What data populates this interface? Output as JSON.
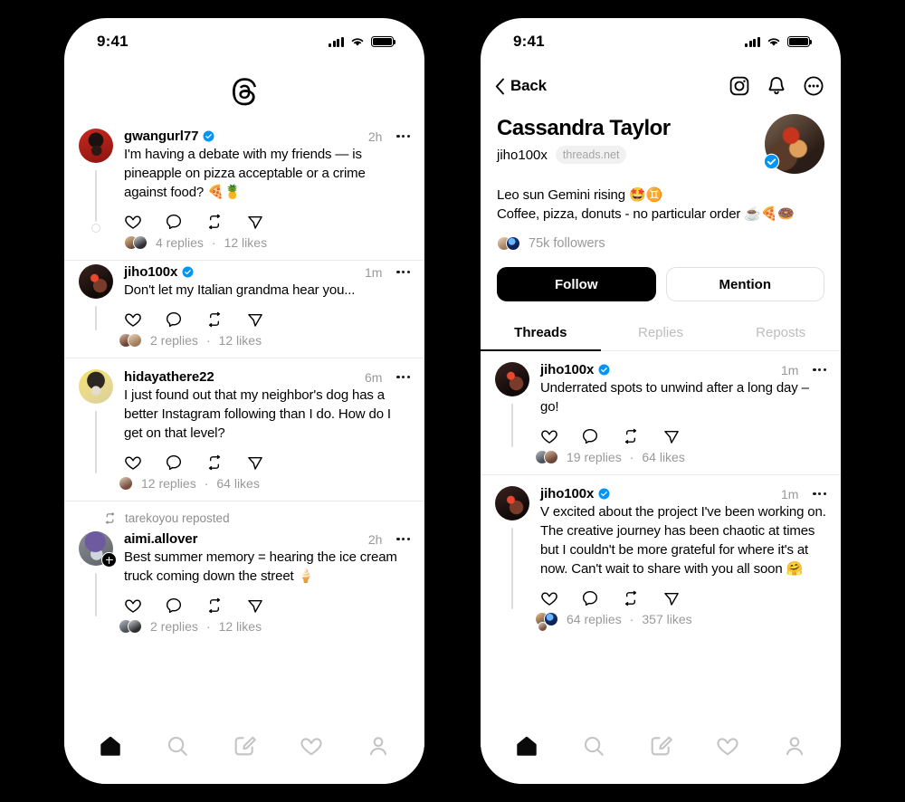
{
  "status_bar": {
    "time": "9:41",
    "signal_icon": "cellular-bars-icon",
    "wifi_icon": "wifi-icon",
    "battery_icon": "battery-full-icon"
  },
  "left_phone": {
    "header": {
      "logo": "threads-logo-icon"
    },
    "posts": [
      {
        "username": "gwangurl77",
        "verified": true,
        "timestamp": "2h",
        "text": "I'm having a debate with my friends — is pineapple on pizza acceptable or a crime against food? 🍕🍍",
        "replies": "4 replies",
        "separator": "·",
        "likes": "12 likes",
        "avatar": "a-gwangurl"
      },
      {
        "username": "jiho100x",
        "verified": true,
        "timestamp": "1m",
        "text": "Don't let my Italian grandma hear you...",
        "replies": "2 replies",
        "separator": "·",
        "likes": "12 likes",
        "avatar": "a-jiho"
      },
      {
        "username": "hidayathere22",
        "verified": false,
        "timestamp": "6m",
        "text": "I just found out that my neighbor's dog has a better Instagram following than I do. How do I get on that level?",
        "replies": "12 replies",
        "separator": "·",
        "likes": "64 likes",
        "avatar": "a-hiday"
      },
      {
        "repost_label": "tarekoyou reposted",
        "repost_icon": "repost-icon",
        "username": "aimi.allover",
        "verified": false,
        "timestamp": "2h",
        "text": "Best summer memory = hearing the ice cream truck coming down the street 🍦",
        "replies": "2 replies",
        "separator": "·",
        "likes": "12 likes",
        "avatar": "a-aimi",
        "follow_badge": true
      }
    ],
    "post_actions": [
      "like-icon",
      "comment-icon",
      "repost-icon",
      "share-icon"
    ],
    "bottom_nav": [
      {
        "icon": "home-icon",
        "active": true
      },
      {
        "icon": "search-icon",
        "active": false
      },
      {
        "icon": "compose-icon",
        "active": false
      },
      {
        "icon": "activity-heart-icon",
        "active": false
      },
      {
        "icon": "profile-person-icon",
        "active": false
      }
    ]
  },
  "right_phone": {
    "nav": {
      "back_label": "Back",
      "back_icon": "chevron-left-icon",
      "actions": [
        "instagram-icon",
        "bell-icon",
        "more-circle-icon"
      ]
    },
    "profile": {
      "display_name": "Cassandra Taylor",
      "handle": "jiho100x",
      "handle_chip": "threads.net",
      "verified": true,
      "bio_line_1": "Leo sun Gemini rising 🤩♊",
      "bio_line_2": "Coffee, pizza, donuts - no particular order ☕🍕🍩",
      "followers": "75k followers",
      "follow_button": "Follow",
      "mention_button": "Mention",
      "avatar": "a-cass"
    },
    "tabs": [
      {
        "label": "Threads",
        "active": true
      },
      {
        "label": "Replies",
        "active": false
      },
      {
        "label": "Reposts",
        "active": false
      }
    ],
    "posts": [
      {
        "username": "jiho100x",
        "verified": true,
        "timestamp": "1m",
        "text": "Underrated spots to unwind after a long day – go!",
        "replies": "19 replies",
        "separator": "·",
        "likes": "64 likes",
        "avatar": "a-jiho"
      },
      {
        "username": "jiho100x",
        "verified": true,
        "timestamp": "1m",
        "text": "V excited about the project I've been working on. The creative journey has been chaotic at times but I couldn't be more grateful for where it's at now. Can't wait to share with you all soon 🤗",
        "replies": "64 replies",
        "separator": "·",
        "likes": "357 likes",
        "avatar": "a-jiho"
      }
    ],
    "post_actions": [
      "like-icon",
      "comment-icon",
      "repost-icon",
      "share-icon"
    ],
    "bottom_nav": [
      {
        "icon": "home-icon",
        "active": true
      },
      {
        "icon": "search-icon",
        "active": false
      },
      {
        "icon": "compose-icon",
        "active": false
      },
      {
        "icon": "activity-heart-icon",
        "active": false
      },
      {
        "icon": "profile-person-icon",
        "active": false
      }
    ]
  },
  "colors": {
    "background": "#000000",
    "surface": "#ffffff",
    "verified_blue": "#0095f6",
    "muted_text": "#999999",
    "divider": "#ebebeb"
  }
}
